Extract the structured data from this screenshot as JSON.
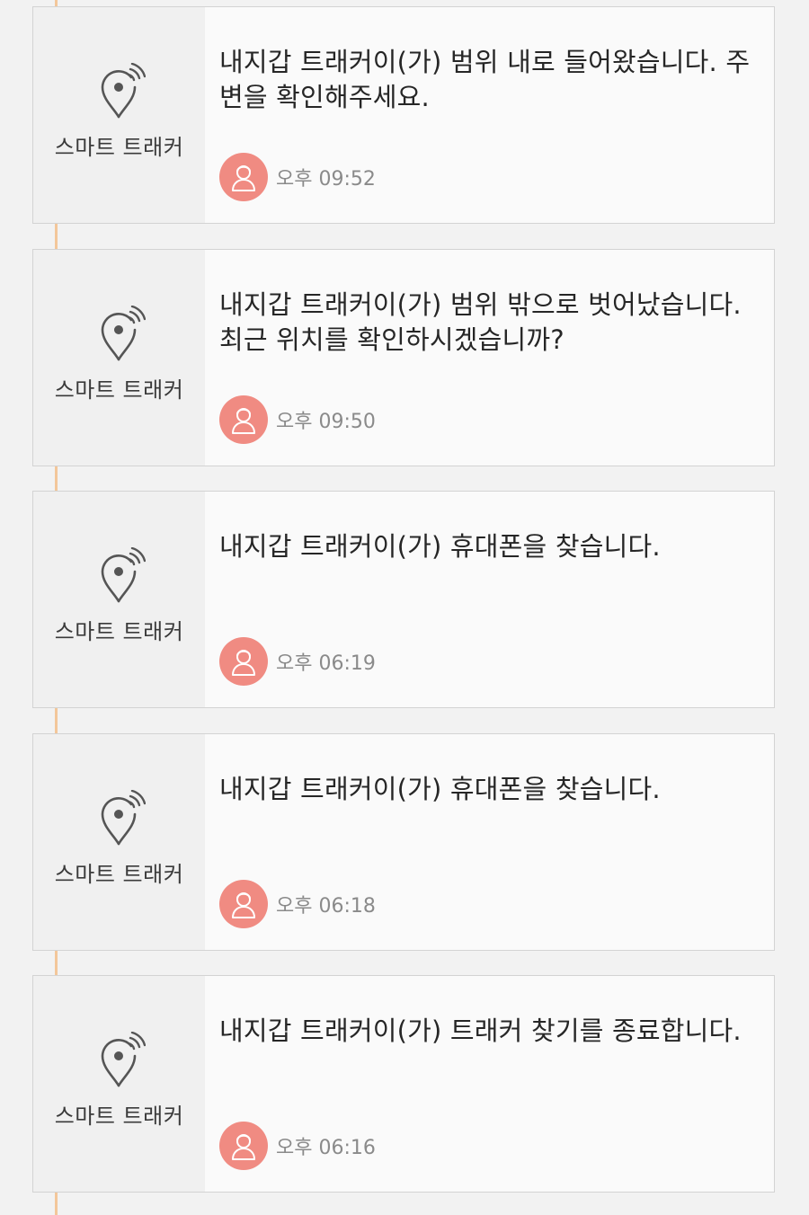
{
  "colors": {
    "page_bg": "#f2f2f2",
    "timeline": "#f3c79a",
    "avatar": "#f08b82",
    "icon": "#555555"
  },
  "notifications": [
    {
      "app": "스마트 트래커",
      "icon": "location-tracker-icon",
      "message": "내지갑 트래커이(가) 범위 내로 들어왔습니다. 주변을 확인해주세요.",
      "time": "오후 09:52"
    },
    {
      "app": "스마트 트래커",
      "icon": "location-tracker-icon",
      "message": "내지갑 트래커이(가) 범위 밖으로 벗어났습니다. 최근 위치를 확인하시겠습니까?",
      "time": "오후 09:50"
    },
    {
      "app": "스마트 트래커",
      "icon": "location-tracker-icon",
      "message": "내지갑 트래커이(가) 휴대폰을 찾습니다.",
      "time": "오후 06:19"
    },
    {
      "app": "스마트 트래커",
      "icon": "location-tracker-icon",
      "message": "내지갑 트래커이(가) 휴대폰을 찾습니다.",
      "time": "오후 06:18"
    },
    {
      "app": "스마트 트래커",
      "icon": "location-tracker-icon",
      "message": "내지갑 트래커이(가) 트래커 찾기를 종료합니다.",
      "time": "오후 06:16"
    }
  ]
}
